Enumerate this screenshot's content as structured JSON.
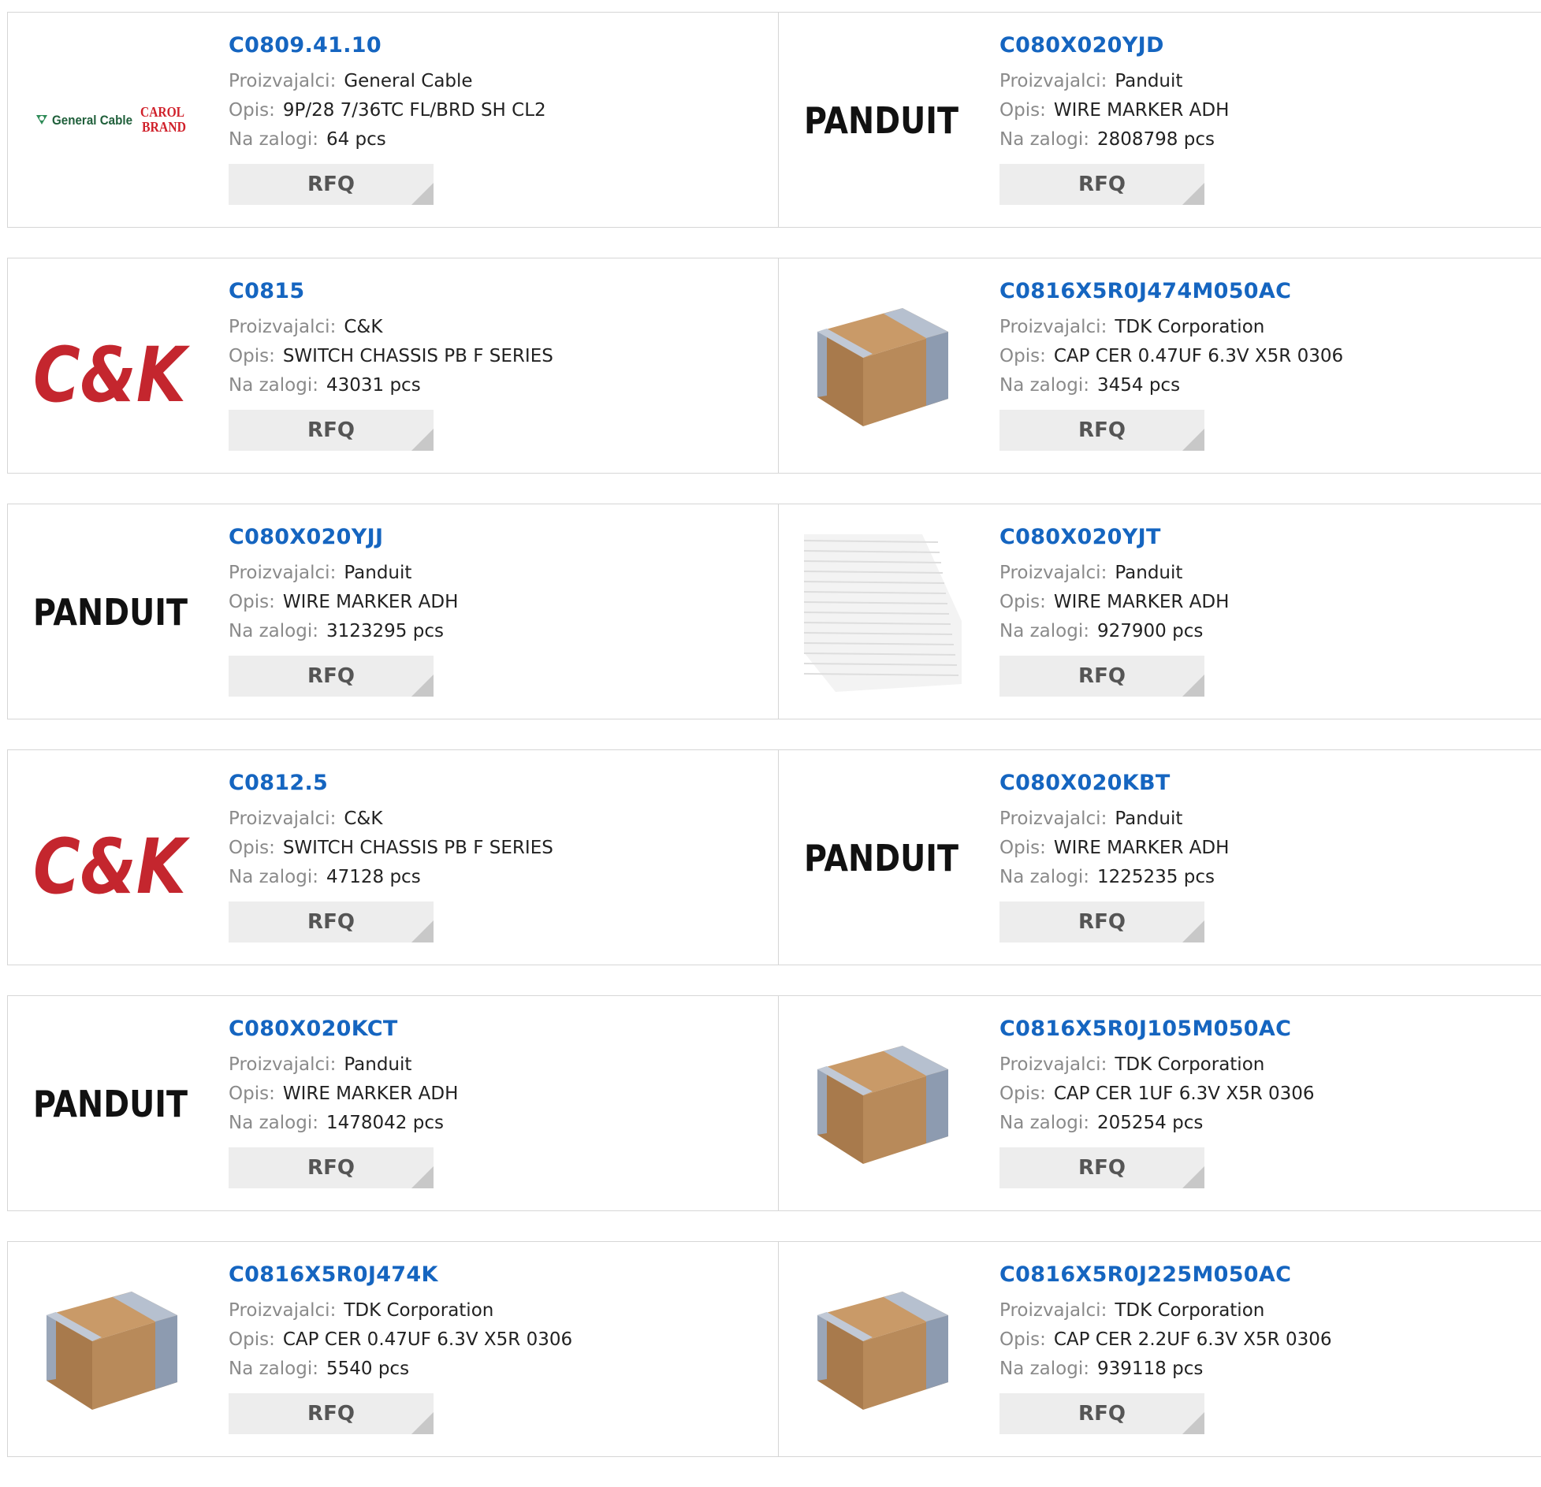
{
  "labels": {
    "manufacturer": "Proizvajalci:",
    "description": "Opis:",
    "stock": "Na zalogi:",
    "rfq": "RFQ"
  },
  "logo_text": {
    "general_cable": "General Cable",
    "carol_1": "CAROL",
    "carol_2": "BRAND",
    "panduit": "PANDUIT",
    "ck": "C&K"
  },
  "products": [
    {
      "part": "C0809.41.10",
      "manufacturer": "General Cable",
      "description": "9P/28 7/36TC FL/BRD SH CL2",
      "stock": "64 pcs",
      "logo": "general-cable"
    },
    {
      "part": "C080X020YJD",
      "manufacturer": "Panduit",
      "description": "WIRE MARKER ADH",
      "stock": "2808798 pcs",
      "logo": "panduit"
    },
    {
      "part": "C0815",
      "manufacturer": "C&K",
      "description": "SWITCH CHASSIS PB F SERIES",
      "stock": "43031 pcs",
      "logo": "ck"
    },
    {
      "part": "C0816X5R0J474M050AC",
      "manufacturer": "TDK Corporation",
      "description": "CAP CER 0.47UF 6.3V X5R 0306",
      "stock": "3454 pcs",
      "logo": "capacitor"
    },
    {
      "part": "C080X020YJJ",
      "manufacturer": "Panduit",
      "description": "WIRE MARKER ADH",
      "stock": "3123295 pcs",
      "logo": "panduit"
    },
    {
      "part": "C080X020YJT",
      "manufacturer": "Panduit",
      "description": "WIRE MARKER ADH",
      "stock": "927900 pcs",
      "logo": "marker-sheet"
    },
    {
      "part": "C0812.5",
      "manufacturer": "C&K",
      "description": "SWITCH CHASSIS PB F SERIES",
      "stock": "47128 pcs",
      "logo": "ck"
    },
    {
      "part": "C080X020KBT",
      "manufacturer": "Panduit",
      "description": "WIRE MARKER ADH",
      "stock": "1225235 pcs",
      "logo": "panduit"
    },
    {
      "part": "C080X020KCT",
      "manufacturer": "Panduit",
      "description": "WIRE MARKER ADH",
      "stock": "1478042 pcs",
      "logo": "panduit"
    },
    {
      "part": "C0816X5R0J105M050AC",
      "manufacturer": "TDK Corporation",
      "description": "CAP CER 1UF 6.3V X5R 0306",
      "stock": "205254 pcs",
      "logo": "capacitor"
    },
    {
      "part": "C0816X5R0J474K",
      "manufacturer": "TDK Corporation",
      "description": "CAP CER 0.47UF 6.3V X5R 0306",
      "stock": "5540 pcs",
      "logo": "capacitor"
    },
    {
      "part": "C0816X5R0J225M050AC",
      "manufacturer": "TDK Corporation",
      "description": "CAP CER 2.2UF 6.3V X5R 0306",
      "stock": "939118 pcs",
      "logo": "capacitor"
    }
  ],
  "colors": {
    "part_link": "#1565c0",
    "label": "#8a8a8a",
    "rfq_bg": "#ededed",
    "border": "#d6d6d6",
    "ck_red": "#c4262e",
    "capacitor_body": "#b88a5a",
    "capacitor_terminal": "#8d9bb0"
  }
}
